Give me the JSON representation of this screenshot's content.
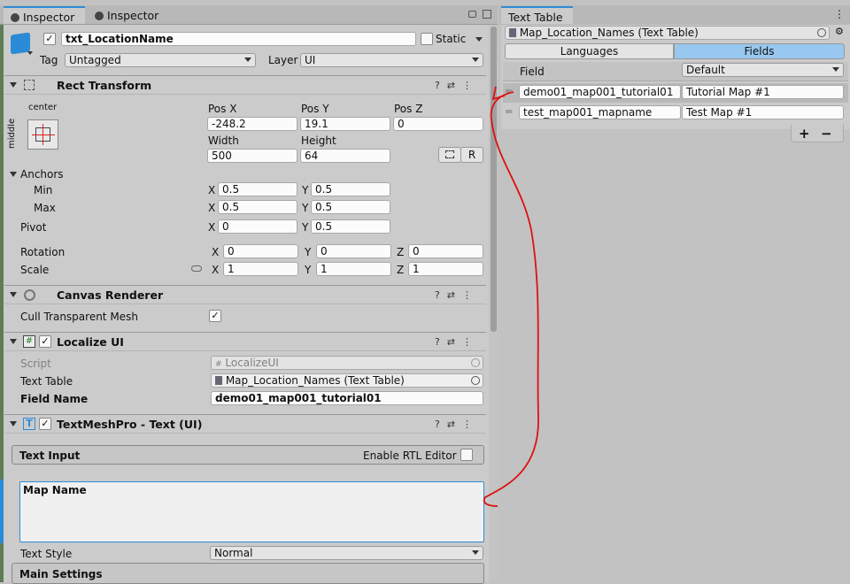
{
  "left_tabs": [
    "Inspector",
    "Inspector"
  ],
  "object": {
    "name": "txt_LocationName",
    "static_label": "Static",
    "tag_label": "Tag",
    "tag_value": "Untagged",
    "layer_label": "Layer",
    "layer_value": "UI"
  },
  "rect": {
    "title": "Rect Transform",
    "anchor_h": "center",
    "anchor_v": "middle",
    "posx_label": "Pos X",
    "posy_label": "Pos Y",
    "posz_label": "Pos Z",
    "posx": "-248.2",
    "posy": "19.1",
    "posz": "0",
    "width_label": "Width",
    "height_label": "Height",
    "width": "500",
    "height": "64",
    "r_button": "R",
    "anchors_label": "Anchors",
    "min_label": "Min",
    "max_label": "Max",
    "min_x": "0.5",
    "min_y": "0.5",
    "max_x": "0.5",
    "max_y": "0.5",
    "pivot_label": "Pivot",
    "pivot_x": "0",
    "pivot_y": "0.5",
    "rotation_label": "Rotation",
    "rot_x": "0",
    "rot_y": "0",
    "rot_z": "0",
    "scale_label": "Scale",
    "scale_x": "1",
    "scale_y": "1",
    "scale_z": "1",
    "x": "X",
    "y": "Y",
    "z": "Z"
  },
  "canvas_renderer": {
    "title": "Canvas Renderer",
    "cull_label": "Cull Transparent Mesh",
    "cull_checked": true
  },
  "localize": {
    "title": "Localize UI",
    "script_label": "Script",
    "script_value": "LocalizeUI",
    "table_label": "Text Table",
    "table_value": "Map_Location_Names (Text Table)",
    "field_label": "Field Name",
    "field_value": "demo01_map001_tutorial01"
  },
  "tmp": {
    "title": "TextMeshPro - Text (UI)",
    "text_input_label": "Text Input",
    "rtl_label": "Enable RTL Editor",
    "text_value": "Map Name",
    "style_label": "Text Style",
    "style_value": "Normal",
    "main_settings": "Main Settings"
  },
  "right": {
    "tab": "Text Table",
    "asset": "Map_Location_Names (Text Table)",
    "tab_languages": "Languages",
    "tab_fields": "Fields",
    "field_header": "Field",
    "default_header": "Default",
    "rows": [
      {
        "key": "demo01_map001_tutorial01",
        "value": "Tutorial Map #1"
      },
      {
        "key": "test_map001_mapname",
        "value": "Test Map #1"
      }
    ],
    "add": "+",
    "remove": "−"
  },
  "colors": {
    "accent_blue": "#2c8bd6",
    "selected_tab": "#98c8f0",
    "annotation_red": "#e01010"
  }
}
